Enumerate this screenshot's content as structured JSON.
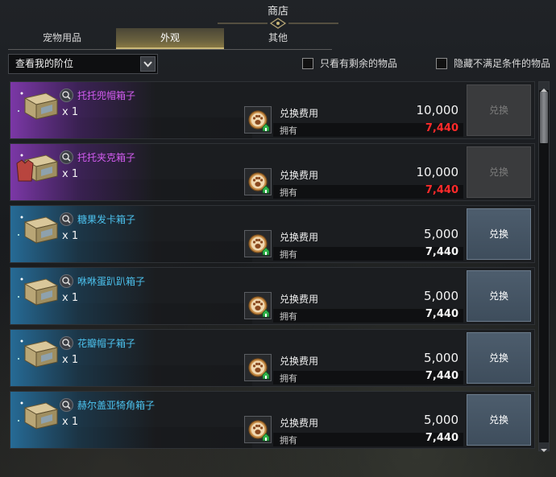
{
  "window": {
    "title": "商店"
  },
  "tabs": [
    {
      "label": "宠物用品",
      "active": false
    },
    {
      "label": "外观",
      "active": true
    },
    {
      "label": "其他",
      "active": false
    }
  ],
  "filter": {
    "dropdown_value": "查看我的阶位",
    "check_only_remaining": {
      "label": "只看有剩余的物品",
      "checked": false
    },
    "check_hide_unmet": {
      "label": "隐藏不满足条件的物品",
      "checked": false
    }
  },
  "items": [
    {
      "name": "托托兜帽箱子",
      "qty": "x 1",
      "cost_label": "兑换费用",
      "cost": "10,000",
      "own_label": "拥有",
      "own": "7,440",
      "own_insufficient": true,
      "rarity": "purple",
      "button": "兑换",
      "enabled": false,
      "icon": "treasure-chest-icon"
    },
    {
      "name": "托托夹克箱子",
      "qty": "x 1",
      "cost_label": "兑换费用",
      "cost": "10,000",
      "own_label": "拥有",
      "own": "7,440",
      "own_insufficient": true,
      "rarity": "purple",
      "button": "兑换",
      "enabled": false,
      "icon": "jacket-chest-icon"
    },
    {
      "name": "糖果发卡箱子",
      "qty": "x 1",
      "cost_label": "兑换费用",
      "cost": "5,000",
      "own_label": "拥有",
      "own": "7,440",
      "own_insufficient": false,
      "rarity": "blue",
      "button": "兑换",
      "enabled": true,
      "icon": "treasure-chest-icon"
    },
    {
      "name": "咻咻蛋趴趴箱子",
      "qty": "x 1",
      "cost_label": "兑换费用",
      "cost": "5,000",
      "own_label": "拥有",
      "own": "7,440",
      "own_insufficient": false,
      "rarity": "blue",
      "button": "兑换",
      "enabled": true,
      "icon": "treasure-chest-icon"
    },
    {
      "name": "花瓣帽子箱子",
      "qty": "x 1",
      "cost_label": "兑换费用",
      "cost": "5,000",
      "own_label": "拥有",
      "own": "7,440",
      "own_insufficient": false,
      "rarity": "blue",
      "button": "兑换",
      "enabled": true,
      "icon": "treasure-chest-icon"
    },
    {
      "name": "赫尔盖亚犄角箱子",
      "qty": "x 1",
      "cost_label": "兑换费用",
      "cost": "5,000",
      "own_label": "拥有",
      "own": "7,440",
      "own_insufficient": false,
      "rarity": "blue",
      "button": "兑换",
      "enabled": true,
      "icon": "treasure-chest-icon"
    }
  ],
  "currency_icon": "paw-cookie-icon",
  "colors": {
    "purple_name": "#d35cf0",
    "blue_name": "#4cc2ee",
    "insufficient": "#ff2a2a",
    "tab_active": "#8e7c45"
  }
}
